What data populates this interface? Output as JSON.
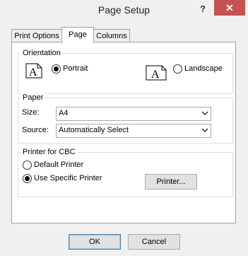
{
  "window": {
    "title": "Page Setup",
    "help_glyph": "?",
    "close_glyph": "✕"
  },
  "tabs": [
    {
      "label": "Print Options",
      "active": false
    },
    {
      "label": "Page",
      "active": true
    },
    {
      "label": "Columns",
      "active": false
    }
  ],
  "orientation": {
    "legend": "Orientation",
    "icon_glyph": "A",
    "portrait_label": "Portrait",
    "landscape_label": "Landscape",
    "selected": "Portrait"
  },
  "paper": {
    "legend": "Paper",
    "size_label": "Size:",
    "size_value": "A4",
    "source_label": "Source:",
    "source_value": "Automatically Select"
  },
  "printer": {
    "legend": "Printer for CBC",
    "default_label": "Default Printer",
    "specific_label": "Use Specific Printer",
    "selected": "Use Specific Printer",
    "printer_button": "Printer..."
  },
  "footer": {
    "ok_label": "OK",
    "cancel_label": "Cancel"
  }
}
